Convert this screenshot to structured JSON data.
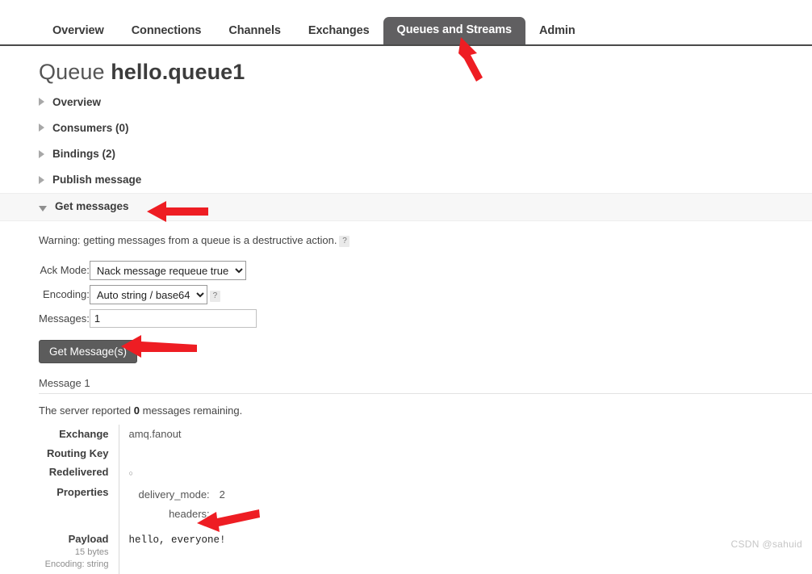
{
  "nav": {
    "tabs": [
      {
        "label": "Overview",
        "active": false
      },
      {
        "label": "Connections",
        "active": false
      },
      {
        "label": "Channels",
        "active": false
      },
      {
        "label": "Exchanges",
        "active": false
      },
      {
        "label": "Queues and Streams",
        "active": true
      },
      {
        "label": "Admin",
        "active": false
      }
    ]
  },
  "page": {
    "title_prefix": "Queue",
    "queue_name": "hello.queue1"
  },
  "sections": [
    {
      "label": "Overview",
      "expanded": false
    },
    {
      "label": "Consumers (0)",
      "expanded": false
    },
    {
      "label": "Bindings (2)",
      "expanded": false
    },
    {
      "label": "Publish message",
      "expanded": false
    },
    {
      "label": "Get messages",
      "expanded": true
    }
  ],
  "get_messages": {
    "warning": "Warning: getting messages from a queue is a destructive action.",
    "warning_help": "?",
    "encoding_help": "?",
    "ack_mode": {
      "label": "Ack Mode:",
      "value": "Nack message requeue true"
    },
    "encoding": {
      "label": "Encoding:",
      "value": "Auto string / base64"
    },
    "messages": {
      "label": "Messages:",
      "value": "1",
      "placeholder": ""
    },
    "submit_label": "Get Message(s)",
    "message_heading": "Message 1",
    "remaining_prefix": "The server reported ",
    "remaining_count": "0",
    "remaining_suffix": " messages remaining."
  },
  "message": {
    "rows": {
      "exchange": {
        "label": "Exchange",
        "value": "amq.fanout"
      },
      "routing_key": {
        "label": "Routing Key",
        "value": ""
      },
      "redelivered": {
        "label": "Redelivered",
        "value": "○"
      },
      "properties": {
        "label": "Properties"
      },
      "payload": {
        "label": "Payload",
        "bytes": "15 bytes",
        "encoding": "Encoding: string",
        "value": "hello, everyone!"
      }
    },
    "properties": [
      {
        "key": "delivery_mode:",
        "value": "2"
      },
      {
        "key": "headers:",
        "value": ""
      }
    ]
  },
  "watermark": "CSDN @sahuid",
  "colors": {
    "active_tab_bg": "#605f61",
    "button_bg": "#5c5c5c",
    "arrow_red": "#ee1d23",
    "section_bg": "#f7f7f7"
  }
}
